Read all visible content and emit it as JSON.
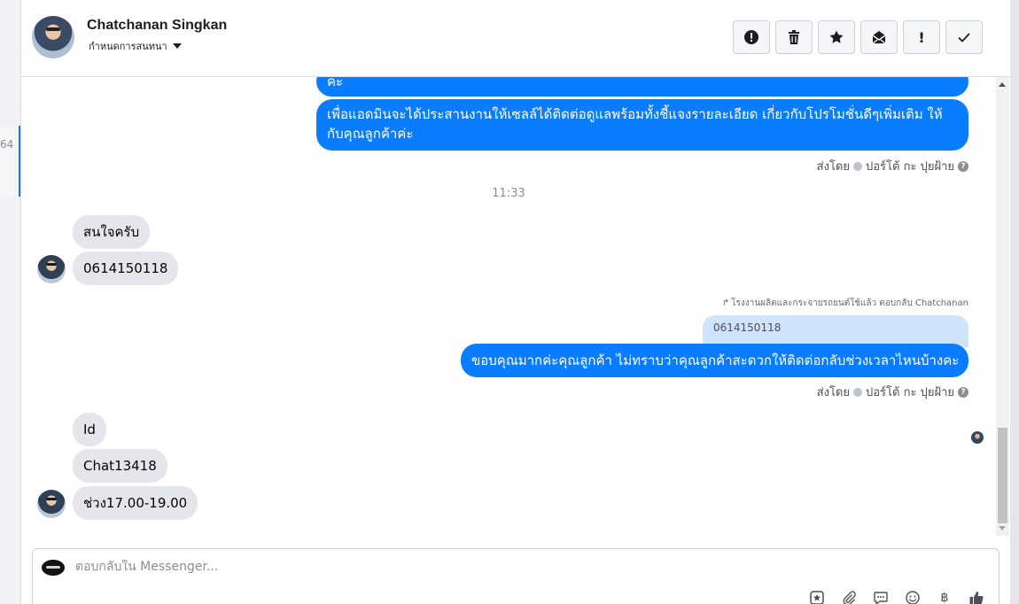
{
  "sidebar_fragment": {
    "text": "64"
  },
  "header": {
    "contact_name": "Chatchanan Singkan",
    "assign_label": "กำหนดการสนทนา",
    "toolbar": [
      {
        "name": "spam-button",
        "icon": "alert-circle-icon"
      },
      {
        "name": "delete-button",
        "icon": "trash-icon"
      },
      {
        "name": "star-button",
        "icon": "star-icon"
      },
      {
        "name": "mark-unread-button",
        "icon": "envelope-icon"
      },
      {
        "name": "mark-important-button",
        "icon": "exclamation-icon",
        "glyph": "!"
      },
      {
        "name": "mark-done-button",
        "icon": "check-icon"
      }
    ]
  },
  "chat": {
    "out_msg_1_tail": "คะ",
    "out_msg_2": "เพื่อแอดมินจะได้ประสานงานให้เซลล์ได้ติดต่อดูแลพร้อมทั้งชี้แจงรายละเอียด เกี่ยวกับโปรโมชั่นดีๆเพิ่มเติม ให้กับคุณลูกค้าค่ะ",
    "sent_by_1": "ส่งโดย",
    "sender_1": "ปอร์โต้ กะ ปุยฝ้าย",
    "time_separator": "11:33",
    "in_msg_1": "สนใจครับ",
    "in_msg_2": "0614150118",
    "reply_note": "โรงงานผลิตและกระจายรถยนต์ใช้แล้ว ตอบกลับ Chatchanan",
    "reply_quote": "0614150118",
    "out_msg_3": "ขอบคุณมากค่ะคุณลูกค้า ไม่ทราบว่าคุณลูกค้าสะดวกให้ติดต่อกลับช่วงเวลาไหนบ้างคะ",
    "sent_by_2": "ส่งโดย",
    "sender_2": "ปอร์โต้ กะ ปุยฝ้าย",
    "in_msg_3": "Id",
    "in_msg_4": "Chat13418",
    "in_msg_5": "ช่วง17.00-19.00",
    "help_glyph": "?"
  },
  "composer": {
    "placeholder": "ตอบกลับใน Messenger...",
    "currency_glyph": "฿"
  },
  "colors": {
    "outgoing_bubble": "#0a7cff",
    "incoming_bubble": "#e4e6eb",
    "reply_quote_bg": "#cfe3fb",
    "accent": "#1877f2"
  }
}
